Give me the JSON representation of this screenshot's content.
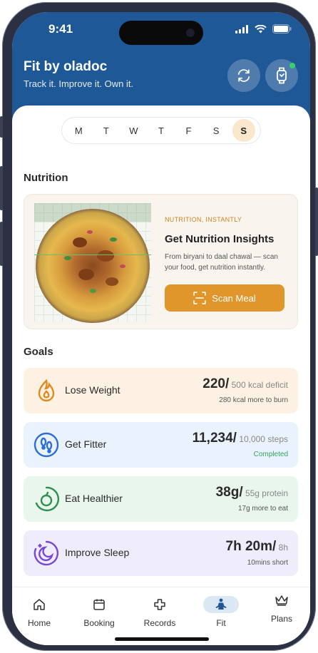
{
  "status_bar": {
    "time": "9:41"
  },
  "header": {
    "title": "Fit by oladoc",
    "tagline": "Track it. Improve it. Own it.",
    "sync_icon": "sync-icon",
    "watch_icon": "smartwatch-icon",
    "watch_status_color": "#36d16b"
  },
  "week": {
    "days": [
      "M",
      "T",
      "W",
      "T",
      "F",
      "S",
      "S"
    ],
    "selected_index": 6
  },
  "nutrition": {
    "section_title": "Nutrition",
    "tag": "NUTRITION, INSTANTLY",
    "heading": "Get Nutrition Insights",
    "description": "From biryani to daal chawal — scan your food, get nutrition instantly.",
    "scan_button": "Scan Meal",
    "accent_color": "#e0962a"
  },
  "goals": {
    "section_title": "Goals",
    "items": [
      {
        "name": "Lose Weight",
        "value": "220/",
        "target": "500 kcal deficit",
        "note": "280 kcal more to burn",
        "icon": "flame-icon",
        "color": "#e08a1e",
        "bg": "#fdf1e4"
      },
      {
        "name": "Get Fitter",
        "value": "11,234/",
        "target": "10,000 steps",
        "note": "Completed",
        "icon": "footsteps-icon",
        "color": "#2b6fd6",
        "bg": "#eaf3fd"
      },
      {
        "name": "Eat Healthier",
        "value": "38g/",
        "target": "55g protein",
        "note": "17g more to eat",
        "icon": "apple-icon",
        "color": "#2f8f4e",
        "bg": "#e9f6ec"
      },
      {
        "name": "Improve Sleep",
        "value": "7h 20m/",
        "target": "8h",
        "note": "10mins short",
        "icon": "moon-icon",
        "color": "#7a46d6",
        "bg": "#efedfb"
      }
    ]
  },
  "tabbar": {
    "tabs": [
      {
        "label": "Home",
        "icon": "home-icon"
      },
      {
        "label": "Booking",
        "icon": "calendar-icon"
      },
      {
        "label": "Records",
        "icon": "medical-cross-icon"
      },
      {
        "label": "Fit",
        "icon": "meditation-icon"
      },
      {
        "label": "Plans",
        "icon": "crown-icon"
      }
    ],
    "active_index": 3
  }
}
